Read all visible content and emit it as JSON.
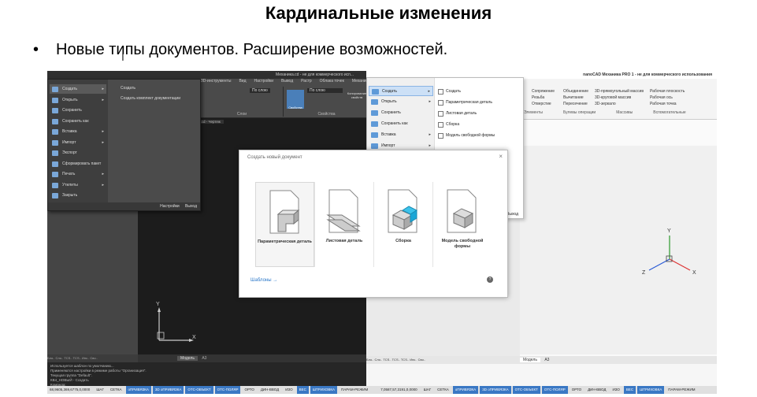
{
  "slide": {
    "title": "Кардинальные изменения",
    "bullet_marker": "•",
    "bullet_text": "Новые типы документов. Расширение возможностей."
  },
  "dark_app": {
    "title": "Механика.cd - не для коммерческого исп...",
    "menubar": [
      "3D-инструменты",
      "Вид",
      "Настройки",
      "Вывод",
      "Растр",
      "Облака точек",
      "Механика"
    ],
    "ribbon_groups": [
      "Слои",
      "Свойства"
    ],
    "layer_label": "По слою",
    "layer_label_2": "По слою",
    "props_button": "Свойства",
    "copy_props_button": "Копирование свойств",
    "drawing_tab": "Механика.cd - Чертеж",
    "file_menu": {
      "items": [
        {
          "label": "Создать",
          "selected": true,
          "has_submenu": true
        },
        {
          "label": "Открыть",
          "selected": false,
          "has_submenu": true
        },
        {
          "label": "Сохранить",
          "selected": false,
          "has_submenu": false
        },
        {
          "label": "Сохранить как",
          "selected": false,
          "has_submenu": false
        },
        {
          "label": "Вставка",
          "selected": false,
          "has_submenu": true
        },
        {
          "label": "Импорт",
          "selected": false,
          "has_submenu": true
        },
        {
          "label": "Экспорт",
          "selected": false,
          "has_submenu": false
        },
        {
          "label": "Сформировать пакет",
          "selected": false,
          "has_submenu": false
        },
        {
          "label": "Печать",
          "selected": false,
          "has_submenu": true
        },
        {
          "label": "Утилиты",
          "selected": false,
          "has_submenu": true
        },
        {
          "label": "Закрыть",
          "selected": false,
          "has_submenu": false
        }
      ],
      "submenu": [
        "Создать",
        "Создать комплект документации"
      ],
      "settings": "Настройки",
      "exit": "Выход"
    },
    "left_tabs": "Бло.. Сло.. TCS.. TCS.. Инс.. Сво..",
    "model_tab": "Модель",
    "layout_tab": "А3",
    "command_lines": [
      "Используется шаблон по умолчанию...",
      "Применяются настройки в режиме работы \"Организация\".",
      "Текущая группа \"Default\".",
      "КВ4_НОВЫЙ - Создать",
      "Команда:"
    ],
    "axis_x": "X",
    "axis_y": "Y"
  },
  "light_app": {
    "title": "nanoCAD Механика PRO 1 - не для коммерческого использования",
    "file_menu": {
      "items": [
        {
          "label": "Создать",
          "selected": true,
          "has_submenu": true
        },
        {
          "label": "Открыть",
          "selected": false,
          "has_submenu": true
        },
        {
          "label": "Сохранить",
          "selected": false,
          "has_submenu": false
        },
        {
          "label": "Сохранить как",
          "selected": false,
          "has_submenu": false
        },
        {
          "label": "Вставка",
          "selected": false,
          "has_submenu": true
        },
        {
          "label": "Импорт",
          "selected": false,
          "has_submenu": true
        }
      ],
      "submenu": [
        "Создать",
        "Параметрическая деталь",
        "Листовая деталь",
        "Сборка",
        "Модель свободной формы"
      ],
      "exit": "Выход"
    },
    "ribbon_items": {
      "col1": [
        "Сопряжение",
        "Резьба",
        "Отверстие"
      ],
      "col2": [
        "Объединение",
        "Вычитание",
        "Пересечение"
      ],
      "col3": [
        "3D-прямоугольный массив",
        "3D-круговой массив",
        "3D-зеркало"
      ],
      "col4": [
        "Рабочая плоскость",
        "Рабочая ось",
        "Рабочая точка"
      ]
    },
    "groups": [
      "Элементы",
      "Булевы операции",
      "Массивы",
      "Вспомогательные"
    ],
    "left_tabs": "Бло.. Сло.. TCS.. TCS.. TCS.. Инс.. Сво..",
    "model_tab": "Модель",
    "layout_tab": "А3",
    "axis_x": "X",
    "axis_y": "Y",
    "axis_z": "Z"
  },
  "dialog": {
    "title": "Создать новый документ",
    "close": "×",
    "cards": [
      {
        "label": "Параметрическая деталь",
        "selected": true
      },
      {
        "label": "Листовая деталь",
        "selected": false
      },
      {
        "label": "Сборка",
        "selected": false
      },
      {
        "label": "Модель свободной формы",
        "selected": false
      }
    ],
    "templates_link": "Шаблоны →",
    "help": "?"
  },
  "status_bar": {
    "left_coords": "68,9605,369,6775,0,0000",
    "left_items": [
      "ШАГ",
      "СЕТКА",
      "оПРИВЯЗКА",
      "3D оПРИВЯЗКА",
      "ОТС-ОБЪЕКТ",
      "ОТС-ПОЛЯР",
      "ОРТО",
      "ДИН-ВВОД",
      "ИЗО",
      "ВЕС",
      "ШТРИХОВКА",
      "ПАРАМ-РЕЖИМ"
    ],
    "right_coords": "7,0587,57,3191,0,0000",
    "right_items": [
      "ШАГ",
      "СЕТКА",
      "оПРИВЯЗКА",
      "3D оПРИВЯЗКА",
      "ОТС-ОБЪЕКТ",
      "ОТС-ПОЛЯР",
      "ОРТО",
      "ДИН-ВВОД",
      "ИЗО",
      "ВЕС",
      "ШТРИХОВКА",
      "ПАРАМ-РЕЖИМ"
    ],
    "active": [
      "оПРИВЯЗКА",
      "3D оПРИВЯЗКА",
      "ОТС-ОБЪЕКТ",
      "ОТС-ПОЛЯР",
      "ВЕС",
      "ШТРИХОВКА"
    ]
  },
  "colors": {
    "accent_blue": "#2a77c9",
    "dark_bg": "#1c1c1c",
    "status_active": "#3a78c4"
  }
}
